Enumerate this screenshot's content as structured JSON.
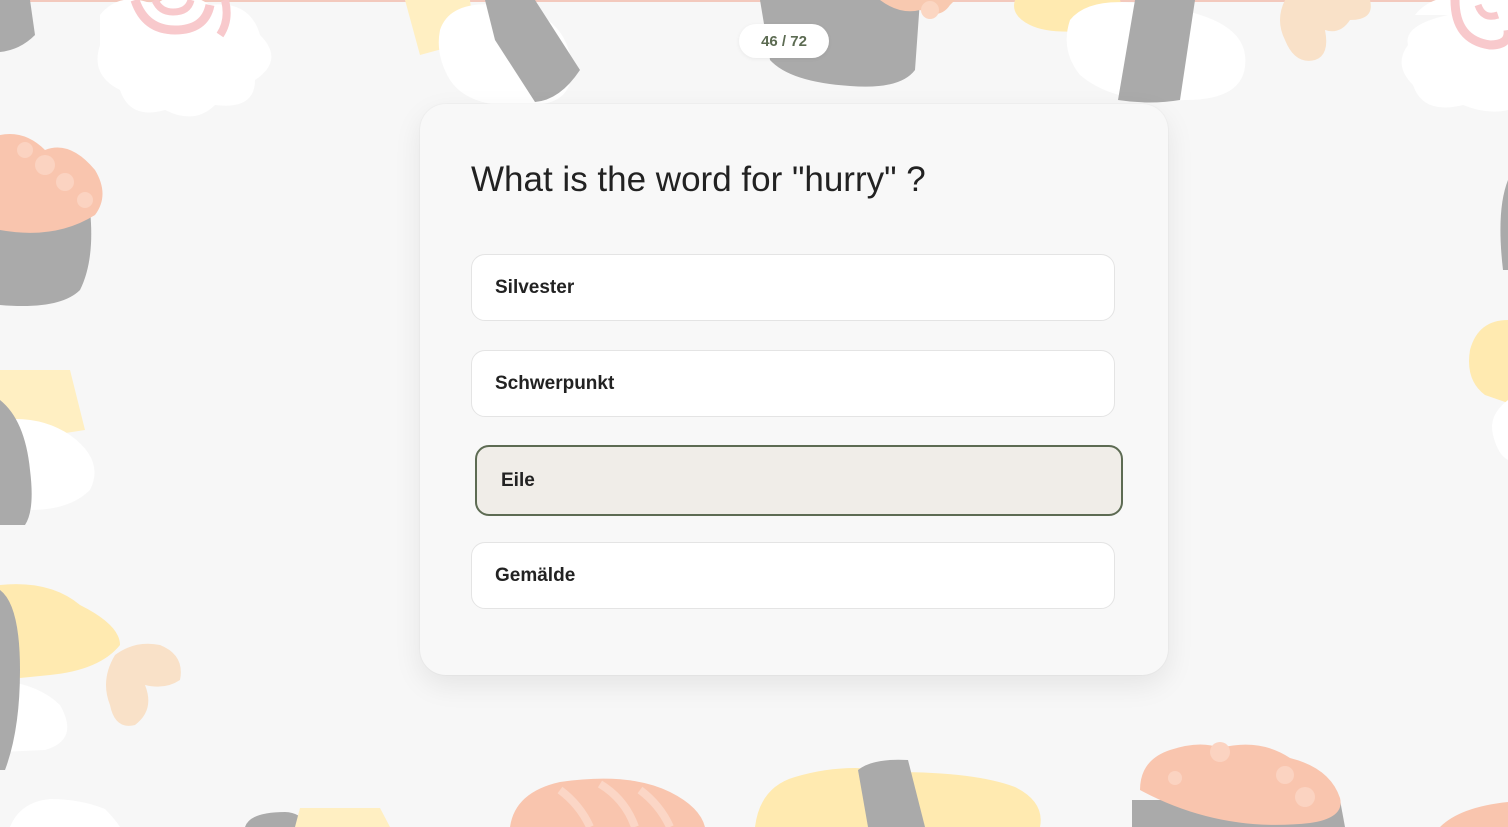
{
  "progress": {
    "label": "46 / 72",
    "current": 46,
    "total": 72
  },
  "question": {
    "text": "What is the word for \"hurry\" ?"
  },
  "options": [
    {
      "label": "Silvester",
      "selected": false
    },
    {
      "label": "Schwerpunkt",
      "selected": false
    },
    {
      "label": "Eile",
      "selected": true
    },
    {
      "label": "Gemälde",
      "selected": false
    }
  ],
  "colors": {
    "accent": "#5d6b53",
    "selected_background": "#f0ede8",
    "page_background": "#f7f7f7"
  }
}
